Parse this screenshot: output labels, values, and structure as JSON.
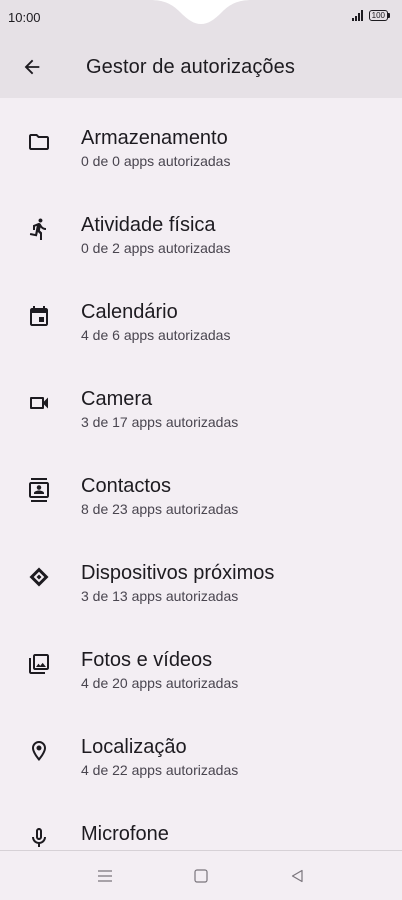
{
  "status_bar": {
    "time": "10:00",
    "battery": "100"
  },
  "app_bar": {
    "title": "Gestor de autorizações",
    "back_icon": "arrow-back-icon"
  },
  "permissions": [
    {
      "label": "Armazenamento",
      "summary": "0 de 0 apps autorizadas",
      "icon": "folder-icon"
    },
    {
      "label": "Atividade física",
      "summary": "0 de 2 apps autorizadas",
      "icon": "running-person-icon"
    },
    {
      "label": "Calendário",
      "summary": "4 de 6 apps autorizadas",
      "icon": "calendar-icon"
    },
    {
      "label": "Camera",
      "summary": "3 de 17 apps autorizadas",
      "icon": "video-camera-icon"
    },
    {
      "label": "Contactos",
      "summary": "8 de 23 apps autorizadas",
      "icon": "contacts-icon"
    },
    {
      "label": "Dispositivos próximos",
      "summary": "3 de 13 apps autorizadas",
      "icon": "nearby-devices-icon"
    },
    {
      "label": "Fotos e vídeos",
      "summary": "4 de 20 apps autorizadas",
      "icon": "photo-library-icon"
    },
    {
      "label": "Localização",
      "summary": "4 de 22 apps autorizadas",
      "icon": "location-pin-icon"
    },
    {
      "label": "Microfone",
      "summary": "",
      "icon": "microphone-icon"
    }
  ],
  "nav_bar": {
    "menu_icon": "menu-icon",
    "home_icon": "home-square-icon",
    "back_icon": "back-triangle-icon"
  }
}
